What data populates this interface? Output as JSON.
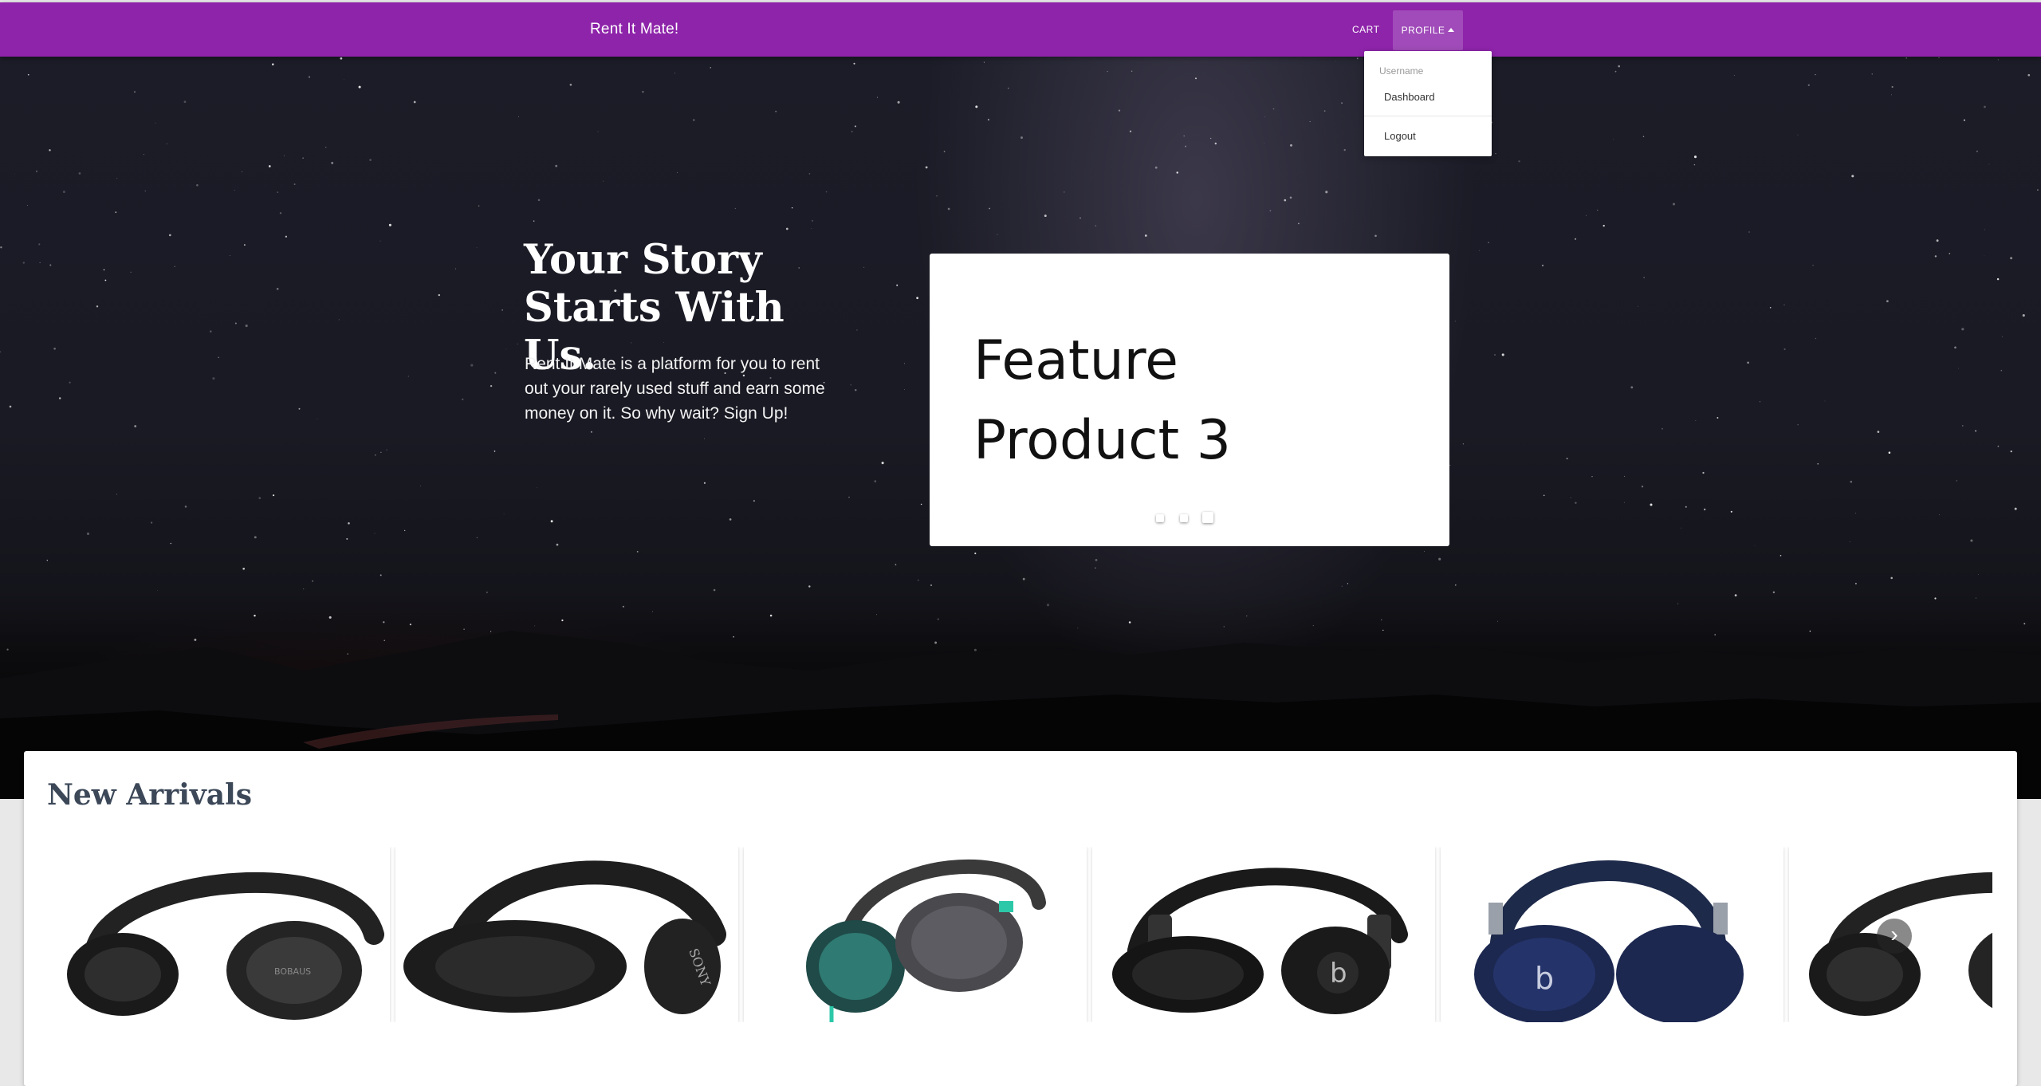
{
  "navbar": {
    "brand": "Rent It Mate!",
    "cart_label": "CART",
    "profile_label": "PROFILE",
    "accent_color": "#8e24aa"
  },
  "profile_menu": {
    "header": "Username",
    "items": [
      {
        "label": "Dashboard"
      },
      {
        "label": "Logout"
      }
    ]
  },
  "hero": {
    "title_line1": "Your Story",
    "title_line2": "Starts With Us.",
    "description": "Rent It Mate is a platform for you to rent out your rarely used stuff and earn some money on it. So why wait? Sign Up!"
  },
  "feature_carousel": {
    "caption_line1": "Feature",
    "caption_line2": "Product 3",
    "slide_count": 3,
    "active_slide": 3
  },
  "new_arrivals": {
    "title": "New Arrivals",
    "products": [
      {
        "icon": "headphones-black-icon",
        "logo": "BOBAUS"
      },
      {
        "icon": "headphones-black-icon",
        "logo": "SONY"
      },
      {
        "icon": "headphones-teal-icon",
        "logo": ""
      },
      {
        "icon": "headphones-beats-black-icon",
        "logo": ""
      },
      {
        "icon": "headphones-beats-blue-icon",
        "logo": ""
      },
      {
        "icon": "headphones-black-icon",
        "logo": ""
      }
    ],
    "next_icon": "chevron-right-icon"
  }
}
